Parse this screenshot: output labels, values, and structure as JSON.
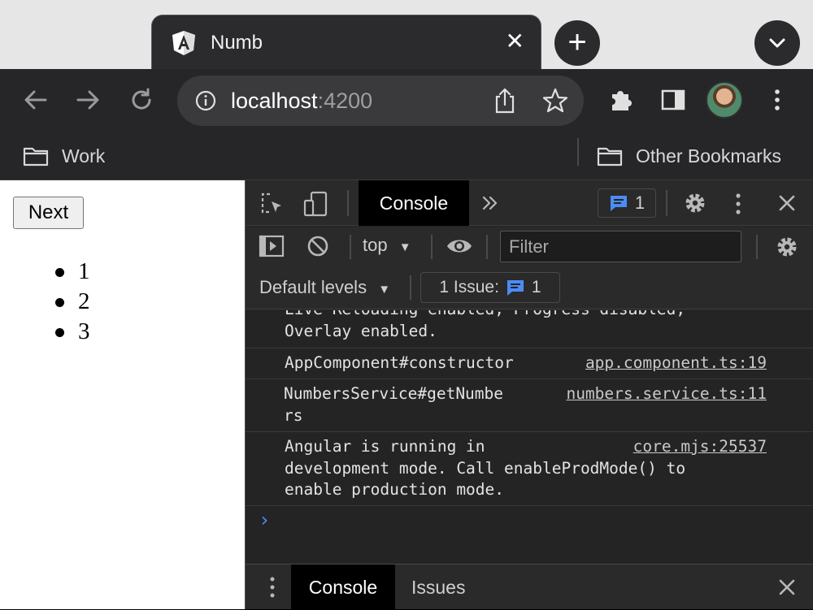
{
  "browser": {
    "tab": {
      "title": "Numb",
      "favicon": "angular-logo-icon"
    },
    "address": {
      "host": "localhost",
      "port": ":4200"
    },
    "bookmarks": [
      "Work",
      "Other Bookmarks"
    ]
  },
  "page": {
    "next_label": "Next",
    "list": [
      "1",
      "2",
      "3"
    ]
  },
  "devtools": {
    "main_tab": "Console",
    "issues_count": "1",
    "context": "top",
    "filter_placeholder": "Filter",
    "levels_label": "Default levels",
    "issue_chip_label": "1 Issue:",
    "issue_chip_count": "1",
    "logs": [
      {
        "message": "Live Reloading enabled, Progress disabled,\nOverlay enabled.",
        "source": ""
      },
      {
        "message": "AppComponent#constructor",
        "source": "app.component.ts:19"
      },
      {
        "message": "NumbersService#getNumbe\nrs",
        "source": "numbers.service.ts:11"
      },
      {
        "message": "Angular is running in\ndevelopment mode. Call enableProdMode() to\nenable production mode.",
        "source": "core.mjs:25537"
      }
    ],
    "drawer": {
      "console": "Console",
      "issues": "Issues"
    }
  },
  "colors": {
    "accent_blue": "#4a8cf7",
    "tab_bg": "#2b2b2d",
    "toolbar_bg": "#262628"
  }
}
